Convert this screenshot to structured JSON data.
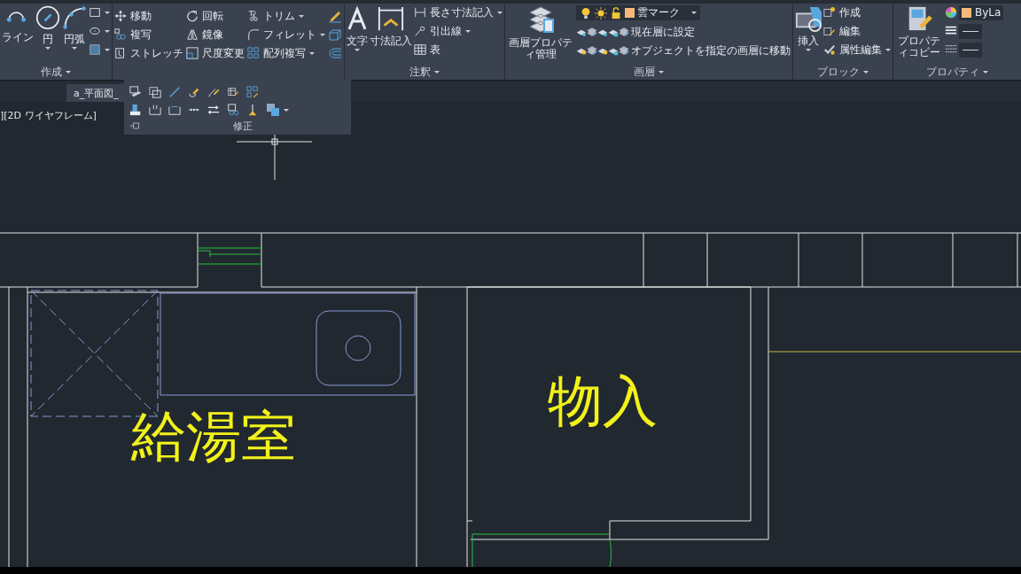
{
  "ribbon": {
    "panels": [
      {
        "kind": "draw",
        "title": "作成",
        "expanded": false,
        "large_tools": [
          "ライン",
          "円",
          "円弧"
        ]
      },
      {
        "kind": "modify",
        "title": "修正",
        "expanded": true,
        "tools": [
          "移動",
          "回転",
          "トリム",
          "複写",
          "鏡像",
          "フィレット",
          "ストレッチ",
          "尺度変更",
          "配列複写"
        ]
      },
      {
        "kind": "annotate",
        "title": "注釈",
        "expanded": false,
        "large_tools": [
          "文字",
          "寸法記入"
        ],
        "tools": [
          "長さ寸法記入",
          "引出線",
          "表"
        ]
      },
      {
        "kind": "layers",
        "title": "画層",
        "expanded": false,
        "large_tools": [
          "画層プロパティ管理"
        ],
        "layer": {
          "name": "雲マーク",
          "color": "#f5b97a"
        },
        "tools": [
          "現在層に設定",
          "オブジェクトを指定の画層に移動"
        ]
      },
      {
        "kind": "block",
        "title": "ブロック",
        "expanded": false,
        "large_tools": [
          "挿入"
        ],
        "tools": [
          "作成",
          "編集",
          "属性編集"
        ]
      },
      {
        "kind": "properties",
        "title": "プロパティ",
        "expanded": false,
        "large_tools": [
          "プロパティコピー"
        ],
        "color_value": "ByLa",
        "color": "#f5b97a"
      }
    ]
  },
  "file_tab": {
    "label": "a_平面図_"
  },
  "viewport_label": "][2D ワイヤフレーム]",
  "drawing": {
    "room_labels": [
      "給湯室",
      "物入"
    ]
  }
}
